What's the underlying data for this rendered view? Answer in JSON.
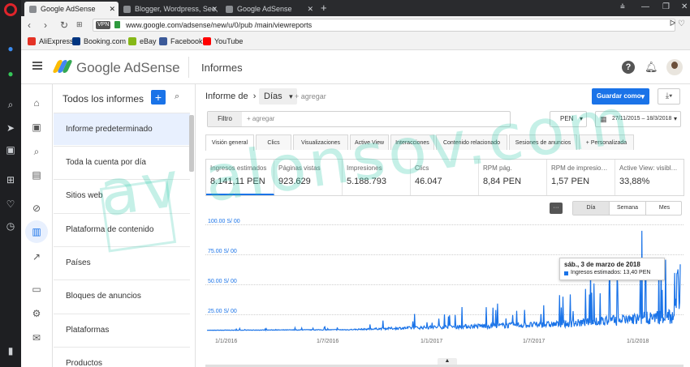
{
  "browser": {
    "tabs": [
      {
        "label": "Google AdSense"
      },
      {
        "label": "Blogger, Wordpress, Seo, …"
      },
      {
        "label": "Google AdSense"
      }
    ],
    "url": "www.google.com/adsense/new/u/0/pub                              /main/viewreports",
    "vpn_label": "VPN",
    "bookmarks": [
      {
        "label": "AliExpress",
        "color": "#e43225"
      },
      {
        "label": "Booking.com",
        "color": "#003580"
      },
      {
        "label": "eBay",
        "color": "#86b817"
      },
      {
        "label": "Facebook",
        "color": "#3b5998"
      },
      {
        "label": "YouTube",
        "color": "#ff0000"
      }
    ]
  },
  "header": {
    "logo_text": "Google AdSense",
    "title": "Informes"
  },
  "reports": {
    "title": "Todos los informes",
    "add_label": "+",
    "items": [
      {
        "label": "Informe predeterminado"
      },
      {
        "label": "Toda la cuenta por día"
      },
      {
        "label": "Sitios web"
      },
      {
        "label": "Plataforma de contenido"
      },
      {
        "label": "Países"
      },
      {
        "label": "Bloques de anuncios"
      },
      {
        "label": "Plataformas"
      },
      {
        "label": "Productos"
      }
    ]
  },
  "report": {
    "breadcrumb": "Informe de",
    "breadcrumb_sep": "›",
    "granularity_select": "Días",
    "add_link": "+ agregar",
    "save_label": "Guardar como",
    "filter_label": "Filtro",
    "filter_add": "+ agregar",
    "currency": "PEN",
    "date_range": "27/11/2015 – 18/3/2018",
    "tabs": [
      {
        "label": "Visión general"
      },
      {
        "label": "Clics"
      },
      {
        "label": "Visualizaciones"
      },
      {
        "label": "Active View"
      },
      {
        "label": "Interacciones"
      },
      {
        "label": "Contenido relacionado"
      },
      {
        "label": "Sesiones de anuncios"
      },
      {
        "label": "+  Personalizada"
      }
    ],
    "metrics": [
      {
        "label": "Ingresos estimados",
        "value": "8.141,11 PEN"
      },
      {
        "label": "Páginas vistas",
        "value": "923.629"
      },
      {
        "label": "Impresiones",
        "value": "5.188.793"
      },
      {
        "label": "Clics",
        "value": "46.047"
      },
      {
        "label": "RPM pág.",
        "value": "8,84 PEN"
      },
      {
        "label": "RPM de impresio…",
        "value": "1,57 PEN"
      },
      {
        "label": "Active View: visibl…",
        "value": "33,88%"
      }
    ],
    "granularity_buttons": [
      {
        "label": "Día"
      },
      {
        "label": "Semana"
      },
      {
        "label": "Mes"
      }
    ],
    "tooltip": {
      "date": "sáb., 3 de marzo de 2018",
      "text": "Ingresos estimados: 13,40 PEN"
    }
  },
  "chart_data": {
    "type": "line",
    "series": [
      {
        "name": "Ingresos estimados",
        "color": "#1a73e8"
      }
    ],
    "y_ticks": [
      "100.00 S/ 00",
      "75.00 S/ 00",
      "50.00 S/ 00",
      "25.00 S/ 00"
    ],
    "x_ticks": [
      "1/1/2016",
      "1/7/2016",
      "1/1/2017",
      "1/7/2017",
      "1/1/2018"
    ],
    "ylim": [
      0,
      100
    ],
    "xlim": [
      "2015-11-27",
      "2018-03-18"
    ]
  },
  "watermark": "av alonsov.com",
  "accent": "#1a73e8"
}
